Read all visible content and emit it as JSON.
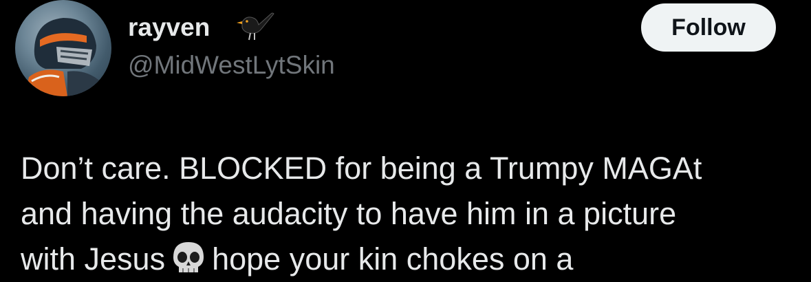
{
  "colors": {
    "background": "#000000",
    "primary_text": "#e7e9ea",
    "secondary_text": "#71767b",
    "follow_button_bg": "#eff3f4",
    "follow_button_text": "#0f1419"
  },
  "author": {
    "display_name": "rayven",
    "name_badge_icon": "blackbird-emoji",
    "handle": "@MidWestLytSkin",
    "avatar_icon": "football-player-avatar"
  },
  "actions": {
    "follow_label": "Follow"
  },
  "tweet": {
    "line1": "Don’t care. BLOCKED for being a Trumpy MAGAt",
    "line2": "and having the audacity to have him in a picture",
    "line3_before_emoji": "with Jesus",
    "line3_emoji_icon": "skull-emoji",
    "line3_after_emoji": "hope your kin chokes on a"
  }
}
